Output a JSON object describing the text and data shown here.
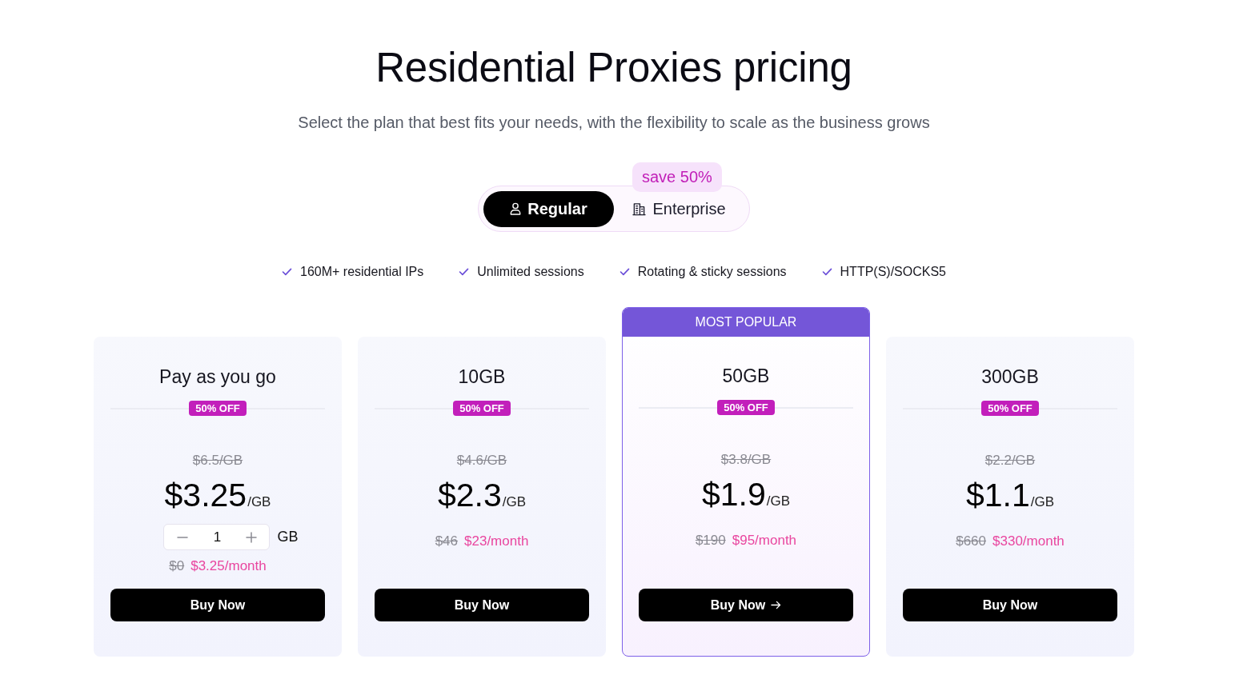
{
  "header": {
    "title": "Residential Proxies pricing",
    "subtitle": "Select the plan that best fits your needs, with the flexibility to scale as the business grows"
  },
  "plan_toggle": {
    "badge": "save 50%",
    "options": [
      {
        "label": "Regular",
        "selected": true
      },
      {
        "label": "Enterprise",
        "selected": false
      }
    ]
  },
  "features": [
    "160M+ residential IPs",
    "Unlimited sessions",
    "Rotating & sticky sessions",
    "HTTP(S)/SOCKS5"
  ],
  "plans": [
    {
      "name": "Pay as you go",
      "popular": false,
      "discount": "50% OFF",
      "old_price": "$6.5/GB",
      "price": "$3.25",
      "unit": "/GB",
      "quantity": {
        "value": "1",
        "unit": "GB"
      },
      "old_total": "$0",
      "total": "$3.25/month",
      "button": "Buy Now"
    },
    {
      "name": "10GB",
      "popular": false,
      "discount": "50% OFF",
      "old_price": "$4.6/GB",
      "price": "$2.3",
      "unit": "/GB",
      "old_total": "$46",
      "total": "$23/month",
      "button": "Buy Now"
    },
    {
      "name": "50GB",
      "popular": true,
      "ribbon": "MOST POPULAR",
      "discount": "50% OFF",
      "old_price": "$3.8/GB",
      "price": "$1.9",
      "unit": "/GB",
      "old_total": "$190",
      "total": "$95/month",
      "button": "Buy Now"
    },
    {
      "name": "300GB",
      "popular": false,
      "discount": "50% OFF",
      "old_price": "$2.2/GB",
      "price": "$1.1",
      "unit": "/GB",
      "old_total": "$660",
      "total": "$330/month",
      "button": "Buy Now"
    }
  ]
}
